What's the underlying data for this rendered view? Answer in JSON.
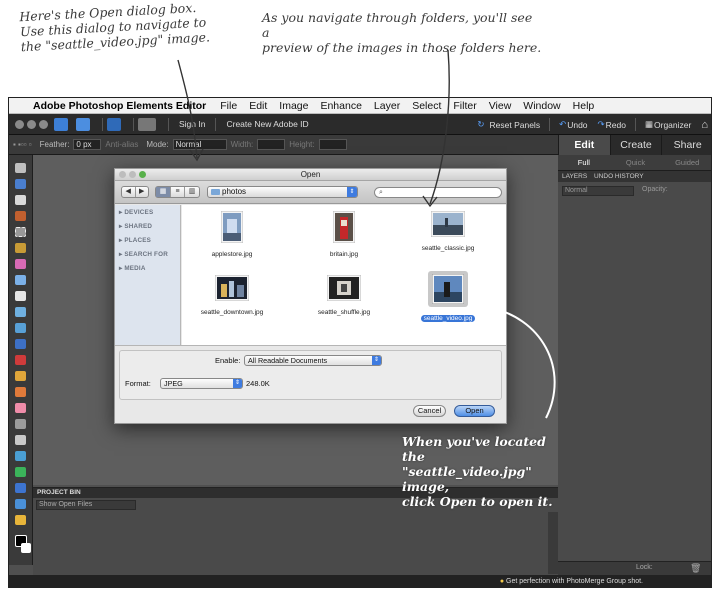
{
  "annotations": {
    "open_dialog": "Here's the Open dialog box.\nUse this dialog to navigate to\nthe \"seattle_video.jpg\" image.",
    "preview": "As you navigate through folders, you'll see a\npreview of the images in those folders here.",
    "click_open": "When you've located the\n\"seattle_video.jpg\" image,\nclick Open to open it."
  },
  "menubar": {
    "app_name": "Adobe Photoshop Elements Editor",
    "items": [
      "File",
      "Edit",
      "Image",
      "Enhance",
      "Layer",
      "Select",
      "Filter",
      "View",
      "Window",
      "Help"
    ]
  },
  "toolbar": {
    "sign_in": "Sign In",
    "create_id": "Create New Adobe ID",
    "reset_panels": "Reset Panels",
    "undo": "Undo",
    "redo": "Redo",
    "organizer": "Organizer"
  },
  "options_bar": {
    "feather_label": "Feather:",
    "feather_value": "0 px",
    "anti_alias": "Anti-alias",
    "mode_label": "Mode:",
    "mode_value": "Normal",
    "width_label": "Width:",
    "height_label": "Height:"
  },
  "right_tabs": {
    "edit": "Edit",
    "create": "Create",
    "share": "Share"
  },
  "edit_subtabs": {
    "full": "Full",
    "quick": "Quick",
    "guided": "Guided"
  },
  "layers_panel": {
    "tab_layers": "LAYERS",
    "tab_undo": "UNDO HISTORY",
    "blend": "Normal",
    "opacity_label": "Opacity:",
    "lock_label": "Lock:"
  },
  "project_bin": {
    "title": "PROJECT BIN",
    "dropdown": "Show Open Files"
  },
  "status_bar": {
    "tip": "Get perfection with PhotoMerge Group shot."
  },
  "dialog": {
    "title": "Open",
    "folder": "photos",
    "search_placeholder": "",
    "sidebar": [
      "DEVICES",
      "SHARED",
      "PLACES",
      "SEARCH FOR",
      "MEDIA"
    ],
    "files": [
      {
        "name": "applestore.jpg",
        "selected": false
      },
      {
        "name": "britain.jpg",
        "selected": false
      },
      {
        "name": "seattle_classic.jpg",
        "selected": false
      },
      {
        "name": "seattle_downtown.jpg",
        "selected": false
      },
      {
        "name": "seattle_shuffle.jpg",
        "selected": false
      },
      {
        "name": "seattle_video.jpg",
        "selected": true
      }
    ],
    "enable_label": "Enable:",
    "enable_value": "All Readable Documents",
    "format_label": "Format:",
    "format_value": "JPEG",
    "file_size": "248.0K",
    "cancel": "Cancel",
    "open": "Open"
  },
  "colors": {
    "selection_blue": "#3875d7",
    "primary_button": "#4f8fe6",
    "app_dark": "#2b2b2b",
    "canvas_gray": "#5e5e5e"
  }
}
